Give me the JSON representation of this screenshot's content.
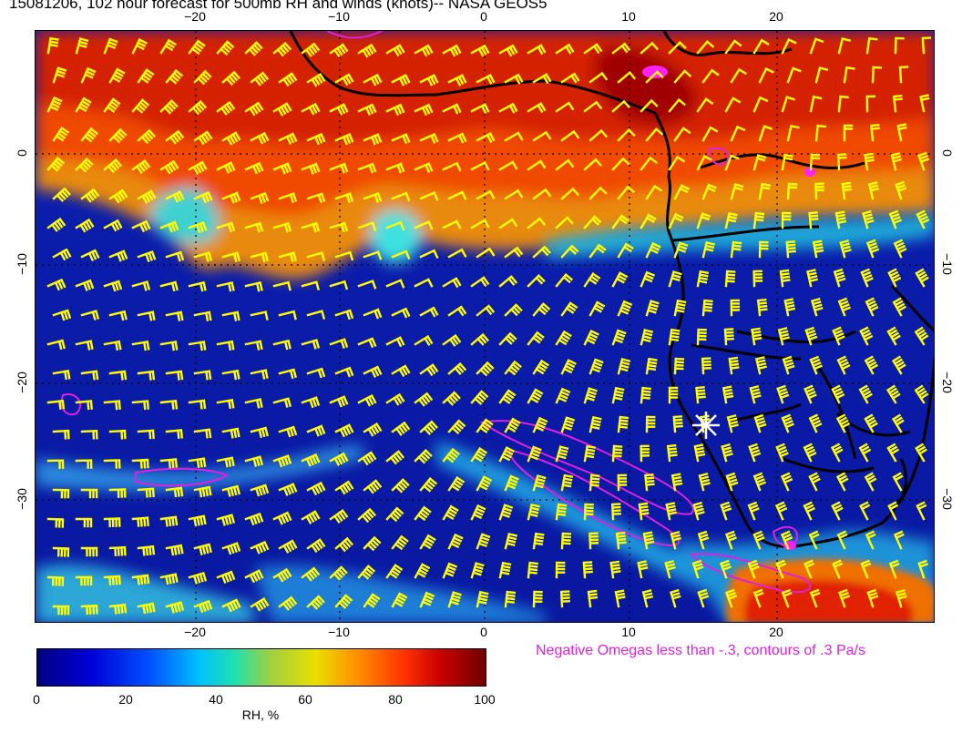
{
  "title": "15081206, 102 hour forecast for 500mb RH and winds (knots)-- NASA GEOS5",
  "axes": {
    "x_ticks": [
      "−20",
      "−10",
      "0",
      "10",
      "20"
    ],
    "y_ticks": [
      "0",
      "−10",
      "−20",
      "−30"
    ],
    "lon_range": [
      -31,
      31
    ],
    "lat_range": [
      8,
      -40
    ]
  },
  "legend": {
    "note": "Negative Omegas less than -.3, contours of .3 Pa/s",
    "colorbar_ticks": [
      "0",
      "20",
      "40",
      "60",
      "80",
      "100"
    ],
    "colorbar_label": "RH, %",
    "colorbar_range": [
      0,
      100
    ]
  },
  "colors": {
    "wind_barbs": "#ffff00",
    "omega_contours": "#e020e0",
    "coastlines": "#000000",
    "marker": "#ffffff",
    "ocean_dry": "#0a1aa0",
    "moist": "#e04000"
  },
  "map": {
    "marker": {
      "lon": 15,
      "lat": -24,
      "symbol": "asterisk"
    }
  }
}
